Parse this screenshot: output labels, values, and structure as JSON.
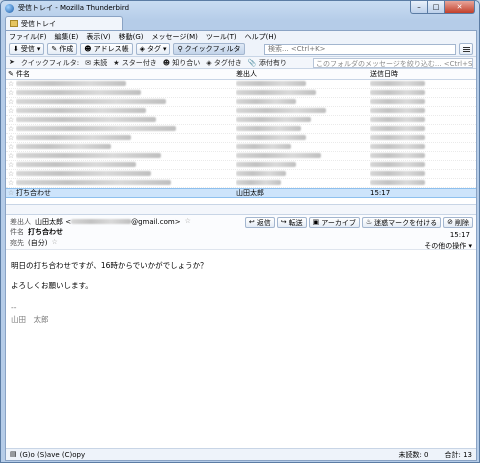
{
  "window": {
    "title": "受信トレイ - Mozilla Thunderbird"
  },
  "tab": {
    "label": "受信トレイ"
  },
  "menu": [
    "ファイル(F)",
    "編集(E)",
    "表示(V)",
    "移動(G)",
    "メッセージ(M)",
    "ツール(T)",
    "ヘルプ(H)"
  ],
  "toolbar": {
    "get": "受信",
    "write": "作成",
    "address_book": "アドレス帳",
    "tag": "タグ",
    "quick_filter": "クイックフィルタ",
    "search_placeholder": "検索... <Ctrl+K>"
  },
  "filterbar": {
    "label": "クイックフィルタ:",
    "unread": "未読",
    "starred": "スター付き",
    "contacts": "知り合い",
    "tags": "タグ付き",
    "attachments": "添付有り",
    "filter_placeholder": "このフォルダのメッセージを絞り込む... <Ctrl+Shift+K>"
  },
  "columns": {
    "subject": "件名",
    "from": "差出人",
    "date": "送信日時"
  },
  "selected_message": {
    "subject": "打ち合わせ",
    "from": "山田太郎",
    "date": "15:17"
  },
  "header": {
    "from_label": "差出人",
    "from_name": "山田太郎",
    "from_email_suffix": "@gmail.com>",
    "subject_label": "件名",
    "subject": "打ち合わせ",
    "to_label": "宛先",
    "to": "(自分)",
    "time": "15:17",
    "other_actions": "その他の操作",
    "actions": {
      "reply": "返信",
      "forward": "転送",
      "archive": "アーカイブ",
      "junk": "迷惑マークを付ける",
      "delete": "削除"
    }
  },
  "body": {
    "line1": "明日の打ち合わせですが、16時からでいかがでしょうか？",
    "line2": "よろしくお願いします。",
    "sig_dash": "--",
    "sig_name": "山田　太郎"
  },
  "status": {
    "text": "(G)o (S)ave (C)opy",
    "unread": "未読数: 0",
    "total": "合計: 13"
  }
}
